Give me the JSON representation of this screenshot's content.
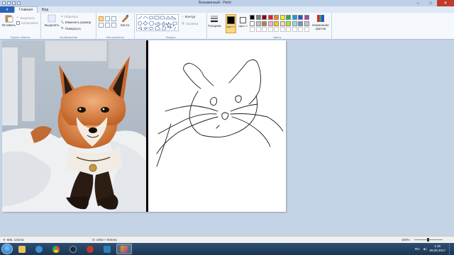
{
  "window": {
    "title": "Безымянный - Paint",
    "controls": {
      "minimize": "–",
      "maximize": "□",
      "close": "✕"
    }
  },
  "tabs": {
    "file": "▾",
    "home": "Главная",
    "view": "Вид"
  },
  "ribbon": {
    "clipboard": {
      "label": "Буфер обмена",
      "paste": "Вставить",
      "cut": "Вырезать",
      "copy": "Копировать"
    },
    "image": {
      "label": "Изображение",
      "select": "Выделить",
      "crop": "Обрезать",
      "resize": "Изменить размер",
      "rotate": "Повернуть"
    },
    "tools": {
      "label": "Инструменты",
      "brushes": "Кисти"
    },
    "shapes": {
      "label": "Фигуры",
      "outline": "Контур",
      "fill": "Заливка"
    },
    "size": {
      "label": "Толщина"
    },
    "colors": {
      "label": "Цвета",
      "color1_label": "Цвет 1",
      "color2_label": "Цвет 2",
      "edit_colors": "Изменение цветов",
      "color1": "#000000",
      "color2": "#ffffff",
      "palette_row1": [
        "#000000",
        "#7f7f7f",
        "#880015",
        "#ed1c24",
        "#ff7f27",
        "#fff200",
        "#22b14c",
        "#00a2e8",
        "#3f48cc",
        "#a349a4"
      ],
      "palette_row2": [
        "#ffffff",
        "#c3c3c3",
        "#b97a57",
        "#ffaec9",
        "#ffc90e",
        "#efe4b0",
        "#b5e61d",
        "#99d9ea",
        "#7092be",
        "#c8bfe7"
      ]
    }
  },
  "status": {
    "cursor_pos": "666, 131пкс",
    "canvas_size": "1003 × 604пкс",
    "zoom": "100%"
  },
  "taskbar": {
    "lang": "RU",
    "time": "1:26",
    "date": "09.05.2017",
    "apps": [
      "explorer",
      "media",
      "chrome",
      "steam",
      "app-red",
      "app-blue",
      "paint"
    ]
  }
}
